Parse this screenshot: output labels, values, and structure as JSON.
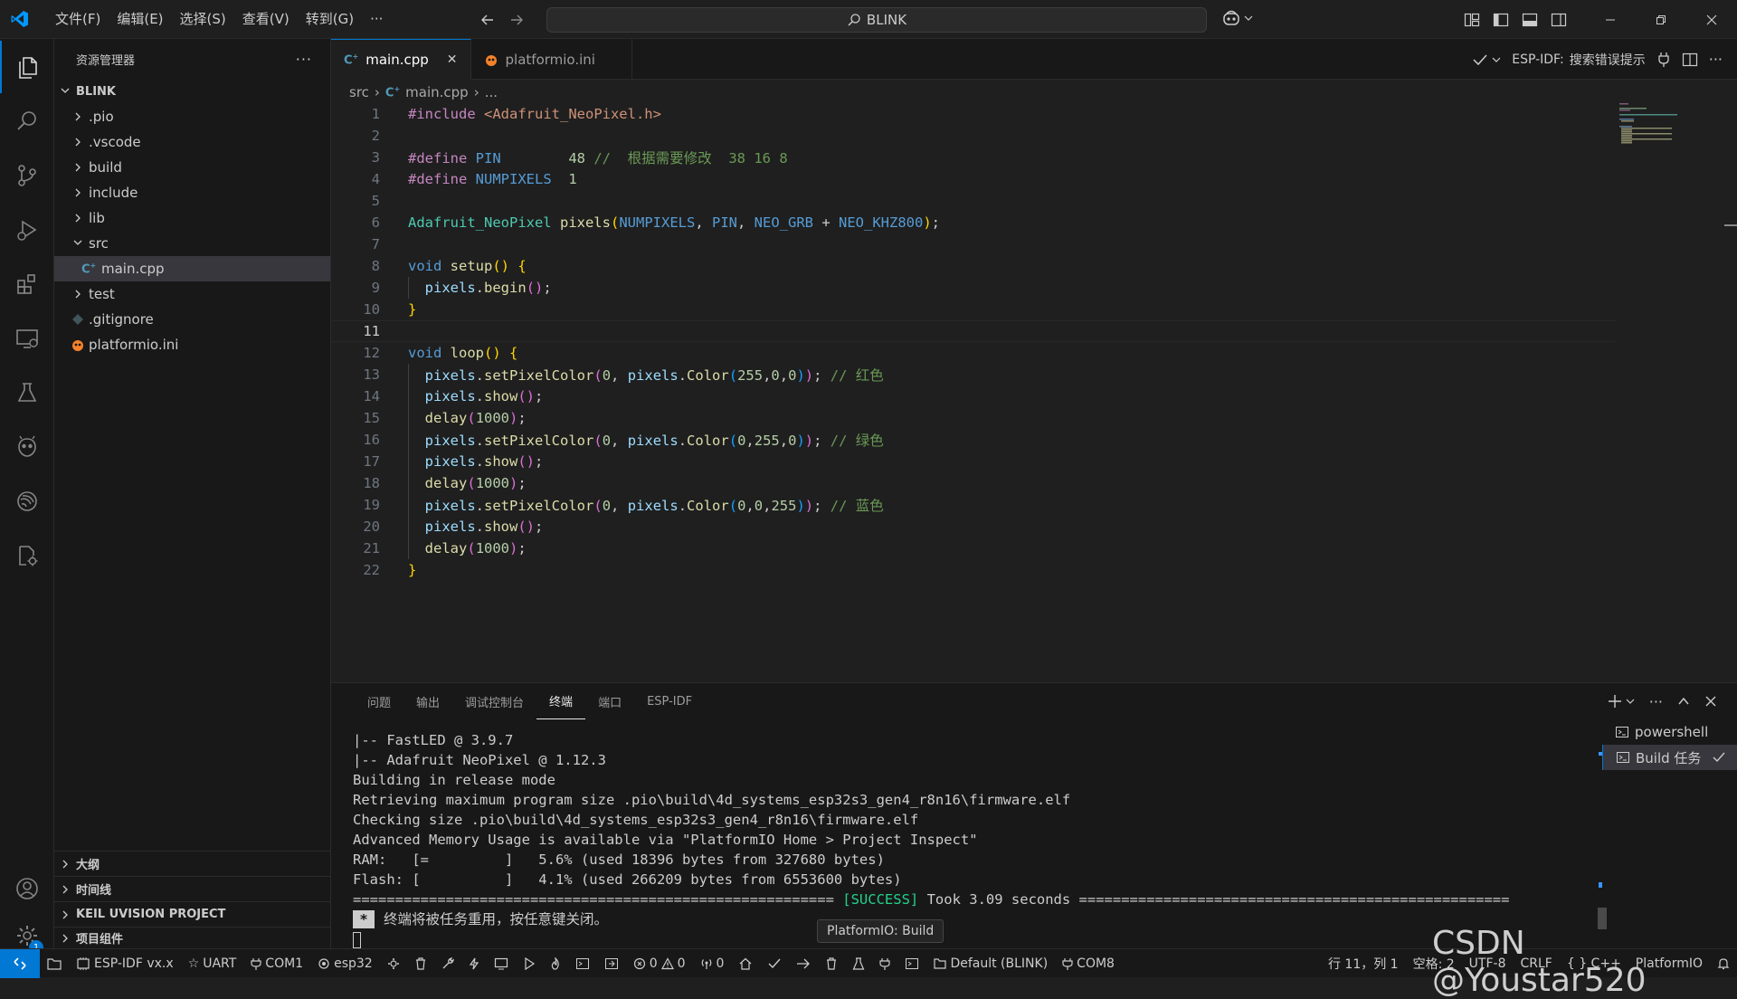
{
  "menu": [
    "文件(F)",
    "编辑(E)",
    "选择(S)",
    "查看(V)",
    "转到(G)",
    "···"
  ],
  "search": {
    "text": "BLINK"
  },
  "sidebar": {
    "title": "资源管理器",
    "root": "BLINK",
    "items": [
      ".pio",
      ".vscode",
      "build",
      "include",
      "lib",
      "src",
      "main.cpp",
      "test",
      ".gitignore",
      "platformio.ini"
    ],
    "bottom_sections": [
      "大纲",
      "时间线",
      "KEIL UVISION PROJECT",
      "项目组件"
    ],
    "badge": "1"
  },
  "tabs": [
    {
      "label": "main.cpp",
      "close": "✕"
    },
    {
      "label": "platformio.ini"
    }
  ],
  "tab_actions": {
    "esp_label": "ESP-IDF:",
    "esp_value": "搜索错误提示"
  },
  "breadcrumb": [
    "src",
    "main.cpp",
    "..."
  ],
  "code": {
    "lines": [
      "1",
      "2",
      "3",
      "4",
      "5",
      "6",
      "7",
      "8",
      "9",
      "10",
      "11",
      "12",
      "13",
      "14",
      "15",
      "16",
      "17",
      "18",
      "19",
      "20",
      "21",
      "22"
    ],
    "current_line": "11",
    "include_kw": "#include",
    "include_file": "<Adafruit_NeoPixel.h>",
    "define_kw": "#define",
    "pin_name": "PIN",
    "pin_value": "48",
    "pin_comment": "//  根据需要修改  38 16 8",
    "numpixels_name": "NUMPIXELS",
    "numpixels_value": "1",
    "class_name": "Adafruit_NeoPixel",
    "obj": "pixels",
    "const1": "NUMPIXELS",
    "const2": "PIN",
    "const3": "NEO_GRB",
    "const4": "NEO_KHZ800",
    "void": "void",
    "setup": "setup",
    "loop": "loop",
    "begin": "begin",
    "set_color": "setPixelColor",
    "color": "Color",
    "show": "show",
    "delay": "delay",
    "delay_ms": "1000",
    "c_red": "// 红色",
    "c_green": "// 绿色",
    "c_blue": "// 蓝色",
    "rgb_red": [
      "255",
      "0",
      "0"
    ],
    "rgb_green": [
      "0",
      "255",
      "0"
    ],
    "rgb_blue": [
      "0",
      "0",
      "255"
    ],
    "zero": "0"
  },
  "panel": {
    "tabs": [
      "问题",
      "输出",
      "调试控制台",
      "终端",
      "端口",
      "ESP-IDF"
    ],
    "active_tab": "终端",
    "terminal_lines": [
      "|-- FastLED @ 3.9.7",
      "|-- Adafruit NeoPixel @ 1.12.3",
      "Building in release mode",
      "Retrieving maximum program size .pio\\build\\4d_systems_esp32s3_gen4_r8n16\\firmware.elf",
      "Checking size .pio\\build\\4d_systems_esp32s3_gen4_r8n16\\firmware.elf",
      "Advanced Memory Usage is available via \"PlatformIO Home > Project Inspect\"",
      "RAM:   [=         ]   5.6% (used 18396 bytes from 327680 bytes)",
      "Flash: [          ]   4.1% (used 266209 bytes from 6553600 bytes)"
    ],
    "success_left": "========================================================= ",
    "success_tag": "[SUCCESS]",
    "success_right": " Took 3.09 seconds ===================================================",
    "reuse_msg": "终端将被任务重用，按任意键关闭。",
    "terminals": [
      "powershell",
      "Build 任务"
    ],
    "tooltip": "PlatformIO: Build"
  },
  "status": {
    "idf": "ESP-IDF vx.x",
    "uart": "UART",
    "com1": "COM1",
    "target": "esp32",
    "errors": "0",
    "warnings": "0",
    "ports": "0",
    "env": "Default (BLINK)",
    "com8": "COM8",
    "position": "行 11，列 1",
    "spaces": "空格: 2",
    "encoding": "UTF-8",
    "eol": "CRLF",
    "lang": "{ } C++",
    "platformio": "PlatformIO"
  },
  "watermark": "CSDN @Youstar520",
  "colors": {
    "accent": "#0078d4",
    "success": "#23d18b",
    "bg": "#1f1f1f"
  }
}
